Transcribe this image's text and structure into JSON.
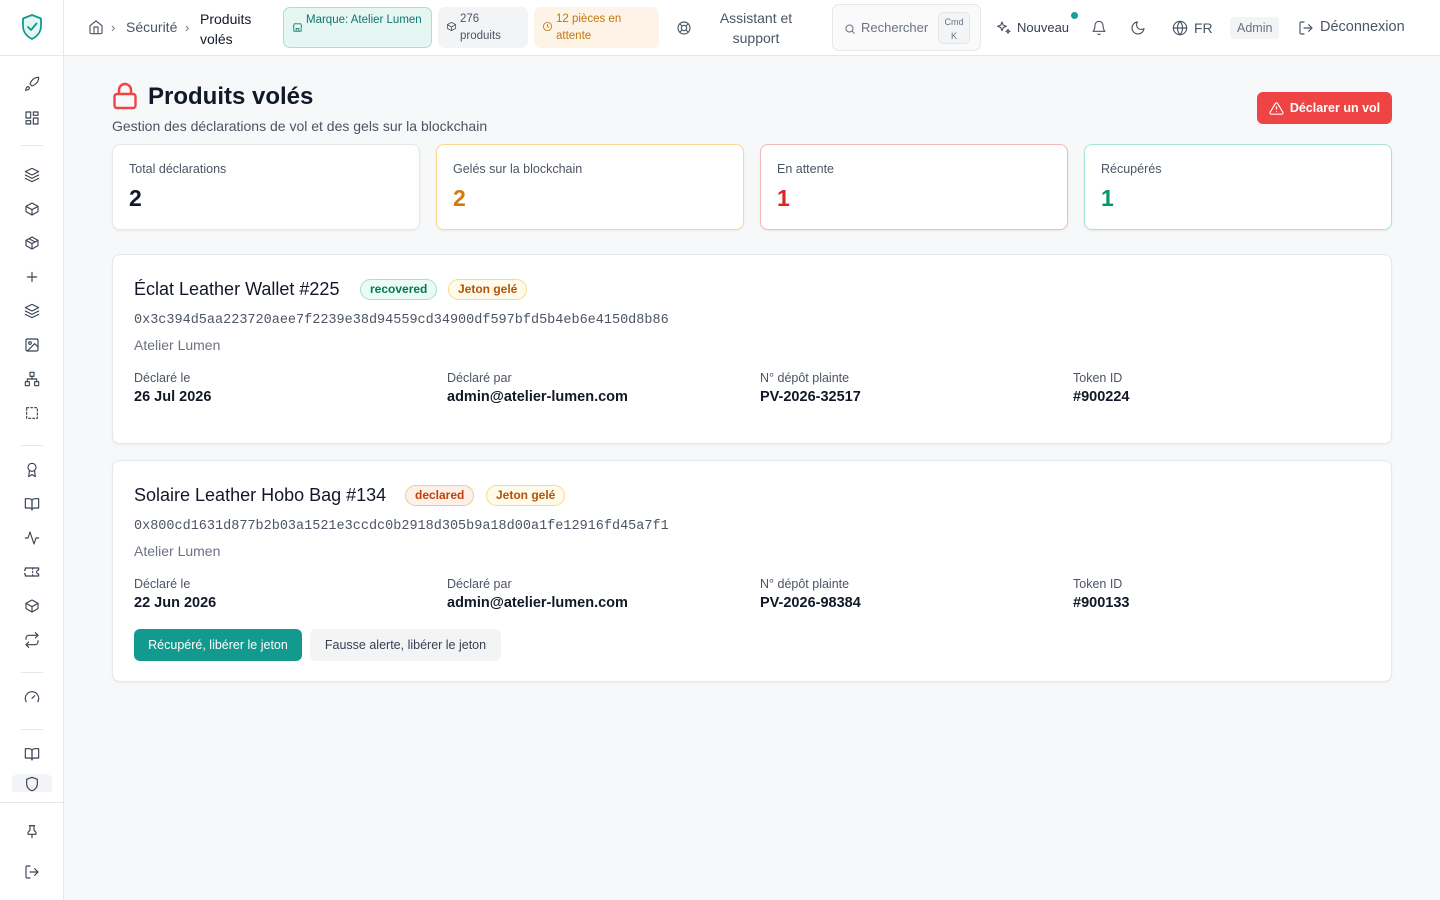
{
  "header": {
    "breadcrumb": {
      "section": "Sécurité",
      "current": "Produits volés"
    },
    "pills": {
      "brand": "Marque: Atelier Lumen",
      "products": "276 produits",
      "pending": "12 pièces en attente"
    },
    "assistant": "Assistant et support",
    "search": {
      "placeholder": "Rechercher",
      "kbd_top": "Cmd",
      "kbd_bottom": "K"
    },
    "new_label": "Nouveau",
    "language": "FR",
    "role": "Admin",
    "logout": "Déconnexion"
  },
  "page": {
    "title": "Produits volés",
    "subtitle": "Gestion des déclarations de vol et des gels sur la blockchain",
    "declare_button": "Déclarer un vol"
  },
  "stats": [
    {
      "label": "Total déclarations",
      "value": "2",
      "color": "#111827",
      "border": "#e5e7eb"
    },
    {
      "label": "Gelés sur la blockchain",
      "value": "2",
      "color": "#d97706",
      "border": "#fcd98a"
    },
    {
      "label": "En attente",
      "value": "1",
      "color": "#dc2626",
      "border": "#f5b7b7"
    },
    {
      "label": "Récupérés",
      "value": "1",
      "color": "#059669",
      "border": "#a7e6cc"
    }
  ],
  "field_labels": {
    "declared_on": "Déclaré le",
    "declared_by": "Déclaré par",
    "complaint": "N° dépôt plainte",
    "token": "Token ID"
  },
  "declarations": [
    {
      "name": "Éclat Leather Wallet #225",
      "status": "recovered",
      "chain_status": "Jeton gelé",
      "hash": "0x3c394d5aa223720aee7f2239e38d94559cd34900df597bfd5b4eb6e4150d8b86",
      "brand": "Atelier Lumen",
      "declared_on": "26 Jul 2026",
      "declared_by": "admin@atelier-lumen.com",
      "complaint": "PV-2026-32517",
      "token": "#900224"
    },
    {
      "name": "Solaire Leather Hobo Bag #134",
      "status": "declared",
      "chain_status": "Jeton gelé",
      "hash": "0x800cd1631d877b2b03a1521e3ccdc0b2918d305b9a18d00a1fe12916fd45a7f1",
      "brand": "Atelier Lumen",
      "declared_on": "22 Jun 2026",
      "declared_by": "admin@atelier-lumen.com",
      "complaint": "PV-2026-98384",
      "token": "#900133",
      "actions": {
        "recovered": "Récupéré, libérer le jeton",
        "false_alarm": "Fausse alerte, libérer le jeton"
      }
    }
  ],
  "colors": {
    "accent": "#129a8e",
    "danger": "#ef4444"
  }
}
